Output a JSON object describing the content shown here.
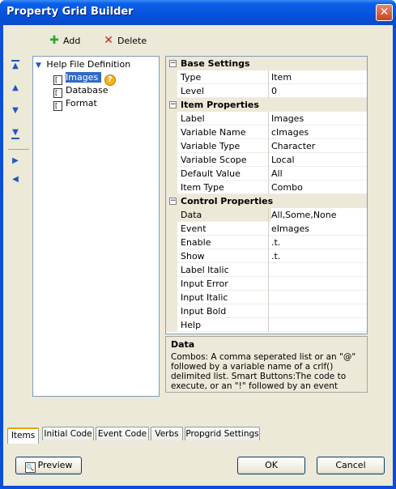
{
  "window": {
    "title": "Property Grid Builder",
    "close_label": "✕"
  },
  "toolbar": {
    "add_label": "Add",
    "delete_label": "Delete"
  },
  "nav": {
    "icons": [
      "move-top-icon",
      "move-up-icon",
      "move-down-icon",
      "move-bottom-icon",
      "indent-icon",
      "outdent-icon"
    ]
  },
  "tree": {
    "root": "Help File Definition",
    "items": [
      {
        "label": "Images",
        "selected": true
      },
      {
        "label": "Database",
        "selected": false
      },
      {
        "label": "Format",
        "selected": false
      }
    ],
    "badge": "?"
  },
  "grid": {
    "categories": [
      {
        "name": "Base Settings",
        "rows": [
          {
            "name": "Type",
            "value": "Item"
          },
          {
            "name": "Level",
            "value": "0"
          }
        ]
      },
      {
        "name": "Item Properties",
        "rows": [
          {
            "name": "Label",
            "value": "Images"
          },
          {
            "name": "Variable Name",
            "value": "cImages"
          },
          {
            "name": "Variable Type",
            "value": "Character"
          },
          {
            "name": "Variable Scope",
            "value": "Local"
          },
          {
            "name": "Default Value",
            "value": "All"
          },
          {
            "name": "Item Type",
            "value": "Combo"
          }
        ]
      },
      {
        "name": "Control Properties",
        "rows": [
          {
            "name": "Data",
            "value": "All,Some,None",
            "selected": true
          },
          {
            "name": "Event",
            "value": "eImages"
          },
          {
            "name": "Enable",
            "value": ".t."
          },
          {
            "name": "Show",
            "value": ".t."
          },
          {
            "name": "Label Italic",
            "value": ""
          },
          {
            "name": "Input Error",
            "value": ""
          },
          {
            "name": "Input Italic",
            "value": ""
          },
          {
            "name": "Input Bold",
            "value": ""
          },
          {
            "name": "Help",
            "value": ""
          }
        ]
      }
    ],
    "collapse_glyph": "−"
  },
  "help": {
    "title": "Data",
    "text": "Combos: A comma seperated list or an \"@\" followed by a variable name of a crlf() delimited list. Smart Buttons:The code to execute, or an \"!\" followed by an event name"
  },
  "tabs": [
    "Items",
    "Initial Code",
    "Event Code",
    "Verbs",
    "Propgrid Settings"
  ],
  "active_tab": "Items",
  "buttons": {
    "preview": "Preview",
    "ok": "OK",
    "cancel": "Cancel"
  },
  "colors": {
    "title_bar": "#0552db",
    "selection": "#316ac5",
    "dialog_bg": "#ece9d8",
    "tab_highlight": "#f0a000"
  }
}
